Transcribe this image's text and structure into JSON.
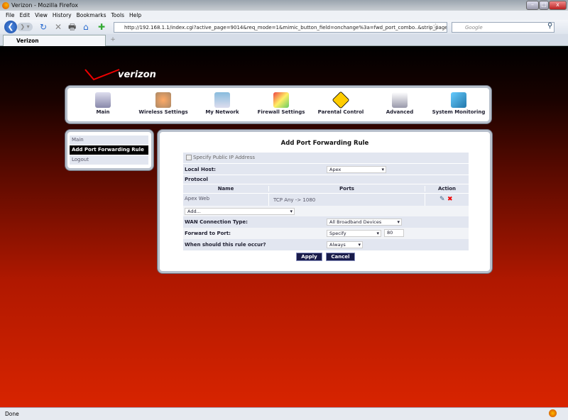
{
  "browser": {
    "title": "Verizon - Mozilla Firefox",
    "menu": [
      "File",
      "Edit",
      "View",
      "History",
      "Bookmarks",
      "Tools",
      "Help"
    ],
    "url": "http://192.168.1.1/index.cgi?active_page=9014&req_mode=1&mimic_button_field=onchange%3a=fwd_port_combo..&strip_page_top=0&buttc",
    "search_placeholder": "Google",
    "tab": "Verizon",
    "status": "Done"
  },
  "logo": "verizon",
  "nav": [
    "Main",
    "Wireless Settings",
    "My Network",
    "Firewall Settings",
    "Parental Control",
    "Advanced",
    "System Monitoring"
  ],
  "sidebar": [
    "Main",
    "Add Port Forwarding Rule",
    "Logout"
  ],
  "form": {
    "title": "Add Port Forwarding Rule",
    "specify_public_ip": "Specify Public IP Address",
    "local_host_label": "Local Host:",
    "local_host_value": "Apex",
    "protocol_label": "Protocol",
    "columns": [
      "Name",
      "Ports",
      "Action"
    ],
    "rows": [
      {
        "name": "Apex Web",
        "ports": "TCP  Any -> 1080"
      }
    ],
    "add_select": "Add...",
    "wan_label": "WAN Connection Type:",
    "wan_value": "All Broadband Devices",
    "forward_label": "Forward to Port:",
    "forward_mode": "Specify",
    "forward_port": "80",
    "when_label": "When should this rule occur?",
    "when_value": "Always",
    "apply": "Apply",
    "cancel": "Cancel"
  },
  "colors": {
    "table_bg": "#e2e6f0",
    "button": "#1a1c4a"
  }
}
